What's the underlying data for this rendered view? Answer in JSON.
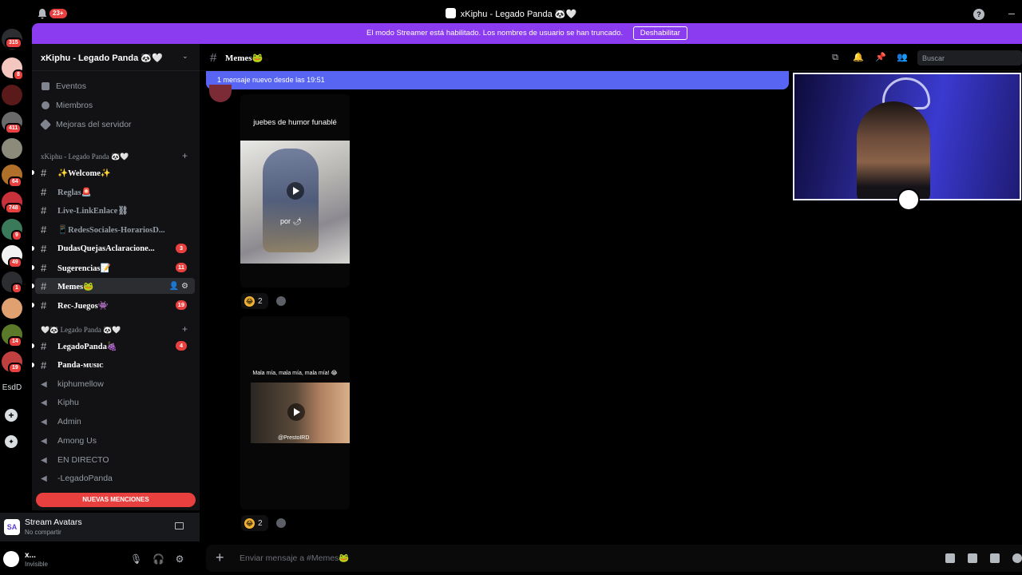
{
  "titlebar": {
    "notif_count": "23+",
    "title": "xKiphu - Legado Panda 🐼🤍",
    "help": "?"
  },
  "banner": {
    "text": "El modo Streamer está habilitado. Los nombres de usuario se han truncado.",
    "button": "Deshabilitar"
  },
  "servers": {
    "badges": [
      "315",
      "8",
      "411",
      "64",
      "748",
      "9",
      "49",
      "1",
      "14",
      "19"
    ],
    "text_server": "EsdD"
  },
  "sidebar": {
    "server_name": "xKiphu - Legado Panda 🐼🤍",
    "nav": [
      "Eventos",
      "Miembros",
      "Mejoras del servidor"
    ],
    "category1": "xKiphu - Legado Panda 🐼🤍",
    "channels1": [
      {
        "name": "✨Welcome✨",
        "badge": ""
      },
      {
        "name": "Reglas🚨",
        "badge": ""
      },
      {
        "name": "Live-LinkEnlace⛓",
        "badge": ""
      },
      {
        "name": "📱RedesSociales-HorariosD...",
        "badge": ""
      },
      {
        "name": "DudasQuejasAclaracione...",
        "badge": "3"
      },
      {
        "name": "Sugerencias📝",
        "badge": "11"
      },
      {
        "name": "Memes🐸",
        "badge": ""
      },
      {
        "name": "Rec-Juegos👾",
        "badge": "19"
      }
    ],
    "category2": "🤍🐼 Legado Panda 🐼🤍",
    "channels2": [
      {
        "name": "LegadoPanda🍇",
        "badge": "4"
      },
      {
        "name": "Panda-ᴍᴜsɪᴄ",
        "badge": ""
      }
    ],
    "voice": [
      "kiphumellow",
      "Kiphu",
      "Admin",
      "Among Us",
      "EN DIRECTO",
      "-LegadoPanda"
    ],
    "mentions": "NUEVAS MENCIONES"
  },
  "stream_panel": {
    "title": "Stream Avatars",
    "subtitle": "No compartir",
    "icon_text": "SA"
  },
  "user_panel": {
    "name": "x...",
    "status": "Invisible"
  },
  "header": {
    "channel": "Memes🐸",
    "search_placeholder": "Buscar"
  },
  "new_messages": "1 mensaje nuevo desde las 19:51",
  "messages": [
    {
      "caption": "juebes de humor funablé",
      "overlay": "por 🌶",
      "reaction_count": "2"
    },
    {
      "caption": "Mala mía, mala mía, mala mía! 😂",
      "watermark": "@PrestoIRD",
      "reaction_count": "2"
    }
  ],
  "composer": {
    "placeholder": "Enviar mensaje a #Memes🐸"
  },
  "colors": {
    "accent": "#5865f2",
    "streamer_banner": "#8b3cf0",
    "mention_red": "#e8403f"
  }
}
